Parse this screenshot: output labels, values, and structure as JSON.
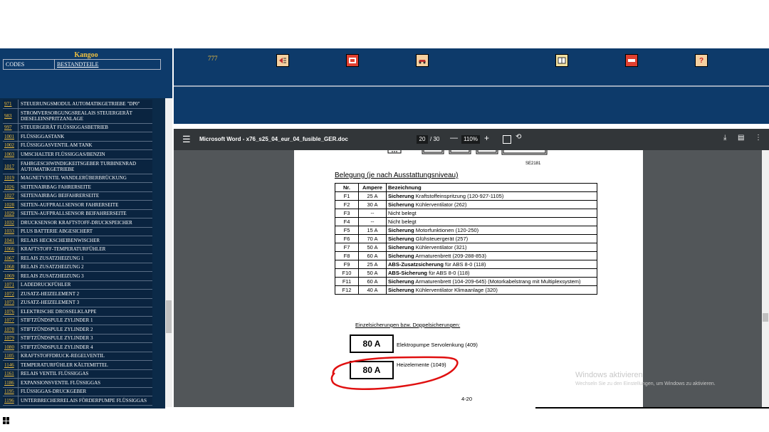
{
  "left_panel": {
    "title": "Kangoo",
    "tab_codes": "CODES",
    "tab_parts": "BESTANDTEILE",
    "items": [
      {
        "code": "971",
        "name": "STEUERUNGSMODUL AUTOMATIKGETRIEBE \"DP0\""
      },
      {
        "code": "983",
        "name": "STROMVERSORGUNGSREALAIS STEUERGERÄT DIESELEINSPRITZANLAGE"
      },
      {
        "code": "997",
        "name": "STEUERGERÄT FLÜSSIGGASBETRIEB"
      },
      {
        "code": "1001",
        "name": "FLÜSSIGGASTANK"
      },
      {
        "code": "1002",
        "name": "FLÜSSIGGASVENTIL AM TANK"
      },
      {
        "code": "1003",
        "name": "UMSCHALTER FLÜSSIGGAS/BENZIN"
      },
      {
        "code": "1017",
        "name": "FAHRGESCHWINDIGKEITSGEBER TURBINENRAD AUTOMATIKGETRIEBE"
      },
      {
        "code": "1019",
        "name": "MAGNETVENTIL WANDLERÜBERBRÜCKUNG"
      },
      {
        "code": "1026",
        "name": "SEITENAIRBAG FAHRERSEITE"
      },
      {
        "code": "1027",
        "name": "SEITENAIRBAG BEIFAHRERSEITE"
      },
      {
        "code": "1028",
        "name": "SEITEN-AUFPRALLSENSOR FAHRERSEITE"
      },
      {
        "code": "1029",
        "name": "SEITEN-AUFPRALLSENSOR BEIFAHRERSEITE"
      },
      {
        "code": "1032",
        "name": "DRUCKSENSOR KRAFTSTOFF-DRUCKSPEICHER"
      },
      {
        "code": "1033",
        "name": "PLUS BATTERIE ABGESICHERT"
      },
      {
        "code": "1041",
        "name": "RELAIS HECKSCHEIBENWISCHER"
      },
      {
        "code": "1066",
        "name": "KRAFTSTOFF-TEMPERATURFÜHLER"
      },
      {
        "code": "1067",
        "name": "RELAIS ZUSATZHEIZUNG 1"
      },
      {
        "code": "1068",
        "name": "RELAIS ZUSATZHEIZUNG 2"
      },
      {
        "code": "1069",
        "name": "RELAIS ZUSATZHEIZUNG 3"
      },
      {
        "code": "1071",
        "name": "LADEDRUCKFÜHLER"
      },
      {
        "code": "1072",
        "name": "ZUSATZ-HEIZELEMENT 2"
      },
      {
        "code": "1073",
        "name": "ZUSATZ-HEIZELEMENT 3"
      },
      {
        "code": "1076",
        "name": "ELEKTRISCHE DROSSELKLAPPE"
      },
      {
        "code": "1077",
        "name": "STIFTZÜNDSPULE ZYLINDER 1"
      },
      {
        "code": "1078",
        "name": "STIFTZÜNDSPULE ZYLINDER 2"
      },
      {
        "code": "1079",
        "name": "STIFTZÜNDSPULE ZYLINDER 3"
      },
      {
        "code": "1080",
        "name": "STIFTZÜNDSPULE ZYLINDER 4"
      },
      {
        "code": "1105",
        "name": "KRAFTSTOFFDRUCK-REGELVENTIL"
      },
      {
        "code": "1146",
        "name": "TEMPERATURFÜHLER KÄLTEMITTEL"
      },
      {
        "code": "1161",
        "name": "RELAIS VENTIL FLÜSSIGGAS"
      },
      {
        "code": "1186",
        "name": "EXPANSIONSVENTIL FLÜSSIGGAS"
      },
      {
        "code": "1195",
        "name": "FLÜSSIGGAS-DRUCKGEBER"
      },
      {
        "code": "1196",
        "name": "UNTERBRECHERRELAIS FÖRDERPUMPE FLÜSSIGGAS"
      }
    ]
  },
  "toolbar": {
    "code": "777",
    "icons": [
      "connector-icon",
      "warning-sign-icon",
      "car-icon",
      "book-icon",
      "fuse-icon",
      "help-icon"
    ]
  },
  "pdf": {
    "title": "Microsoft Word - x76_s25_04_eur_04_fusible_GER.doc",
    "page": "20",
    "total": "/ 30",
    "zoom": "110%"
  },
  "document": {
    "figure_label": "SE2181",
    "heading": "Belegung (je nach Ausstattungsniveau)",
    "columns": [
      "Nr.",
      "Ampere",
      "Bezeichnung"
    ],
    "rows": [
      {
        "nr": "F1",
        "amp": "25 A",
        "bold": "Sicherung",
        "rest": " Kraftstoffeinspritzung (120-927-1105)"
      },
      {
        "nr": "F2",
        "amp": "30 A",
        "bold": "Sicherung",
        "rest": " Kühlerventilator (262)"
      },
      {
        "nr": "F3",
        "amp": "--",
        "bold": "",
        "rest": "Nicht belegt"
      },
      {
        "nr": "F4",
        "amp": "--",
        "bold": "",
        "rest": "Nicht belegt"
      },
      {
        "nr": "F5",
        "amp": "15 A",
        "bold": "Sicherung",
        "rest": " Motorfunktionen (120-250)"
      },
      {
        "nr": "F6",
        "amp": "70 A",
        "bold": "Sicherung",
        "rest": " Glühsteuergerät (257)"
      },
      {
        "nr": "F7",
        "amp": "50 A",
        "bold": "Sicherung",
        "rest": " Kühlerventilator (321)"
      },
      {
        "nr": "F8",
        "amp": "60 A",
        "bold": "Sicherung",
        "rest": " Armaturenbrett (209-288-853)"
      },
      {
        "nr": "F9",
        "amp": "25 A",
        "bold": "ABS-Zusatzsicherung",
        "rest": " für ABS 8-0 (118)"
      },
      {
        "nr": "F10",
        "amp": "50 A",
        "bold": "ABS-Sicherung",
        "rest": " für ABS 8-0 (118)"
      },
      {
        "nr": "F11",
        "amp": "60 A",
        "bold": "Sicherung",
        "rest": " Armaturenbrett (104-209-645) (Motorkabelstrang mit Multiplexsystem)"
      },
      {
        "nr": "F12",
        "amp": "40 A",
        "bold": "Sicherung",
        "rest": " Kühlerventilator Klimaanlage (320)"
      }
    ],
    "single_heading": "Einzelsicherungen bzw. Doppelsicherungen:",
    "fuse1_value": "80 A",
    "fuse1_label": "Elektropumpe Servolenkung (409)",
    "fuse2_value": "80 A",
    "fuse2_label": "Heizelemente (1049)",
    "page_number": "4-20",
    "highlight_color": "#e01010"
  },
  "watermark": {
    "title": "Windows aktivieren",
    "subtitle": "Wechseln Sie zu den Einstellungen, um Windows zu aktivieren."
  }
}
